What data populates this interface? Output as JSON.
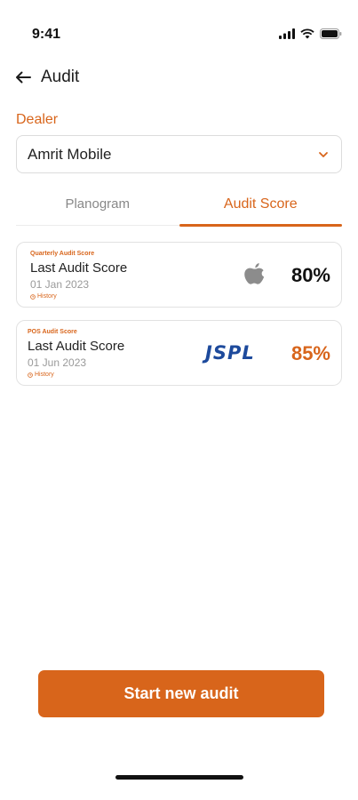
{
  "status_bar": {
    "time": "9:41"
  },
  "header": {
    "title": "Audit"
  },
  "dealer": {
    "label": "Dealer",
    "value": "Amrit Mobile"
  },
  "tabs": [
    {
      "label": "Planogram",
      "active": false
    },
    {
      "label": "Audit Score",
      "active": true
    }
  ],
  "cards": [
    {
      "tag": "Quarterly Audit Score",
      "title": "Last Audit Score",
      "date": "01 Jan 2023",
      "history": "History",
      "brand_icon": "apple-logo",
      "score": "80%"
    },
    {
      "tag": "POS Audit Score",
      "title": "Last Audit Score",
      "date": "01 Jun 2023",
      "history": "History",
      "brand_logo_text": "JSPL",
      "score": "85%"
    }
  ],
  "cta": {
    "label": "Start new audit"
  },
  "colors": {
    "accent": "#d8651b",
    "jspl_blue": "#1d4a9c"
  }
}
